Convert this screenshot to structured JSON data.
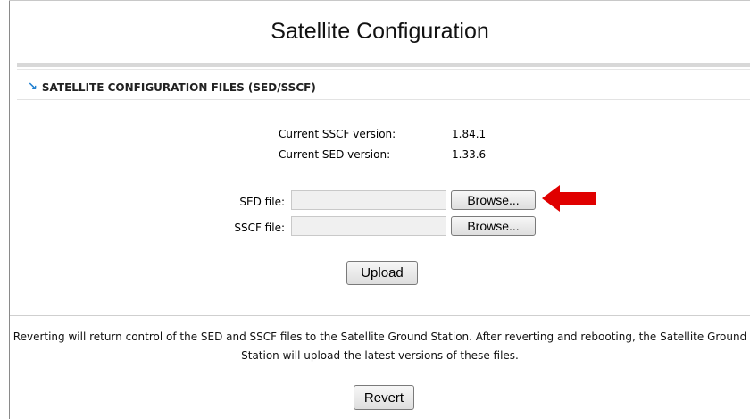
{
  "page": {
    "title": "Satellite Configuration"
  },
  "section": {
    "icon": "arrow-down-right-icon",
    "heading": "SATELLITE CONFIGURATION FILES (SED/SSCF)"
  },
  "versions": [
    {
      "label": "Current SSCF version:",
      "value": "1.84.1"
    },
    {
      "label": "Current SED version:",
      "value": "1.33.6"
    }
  ],
  "files": {
    "sed": {
      "label": "SED file:",
      "value": "",
      "button": "Browse..."
    },
    "sscf": {
      "label": "SSCF file:",
      "value": "",
      "button": "Browse..."
    }
  },
  "upload_button": "Upload",
  "revert": {
    "text": "Reverting will return control of the SED and SSCF files to the Satellite Ground Station. After reverting and rebooting, the Satellite Ground Station will upload the latest versions of these files.",
    "button": "Revert"
  },
  "annotation": {
    "icon": "red-arrow-icon",
    "color": "#e00000"
  }
}
